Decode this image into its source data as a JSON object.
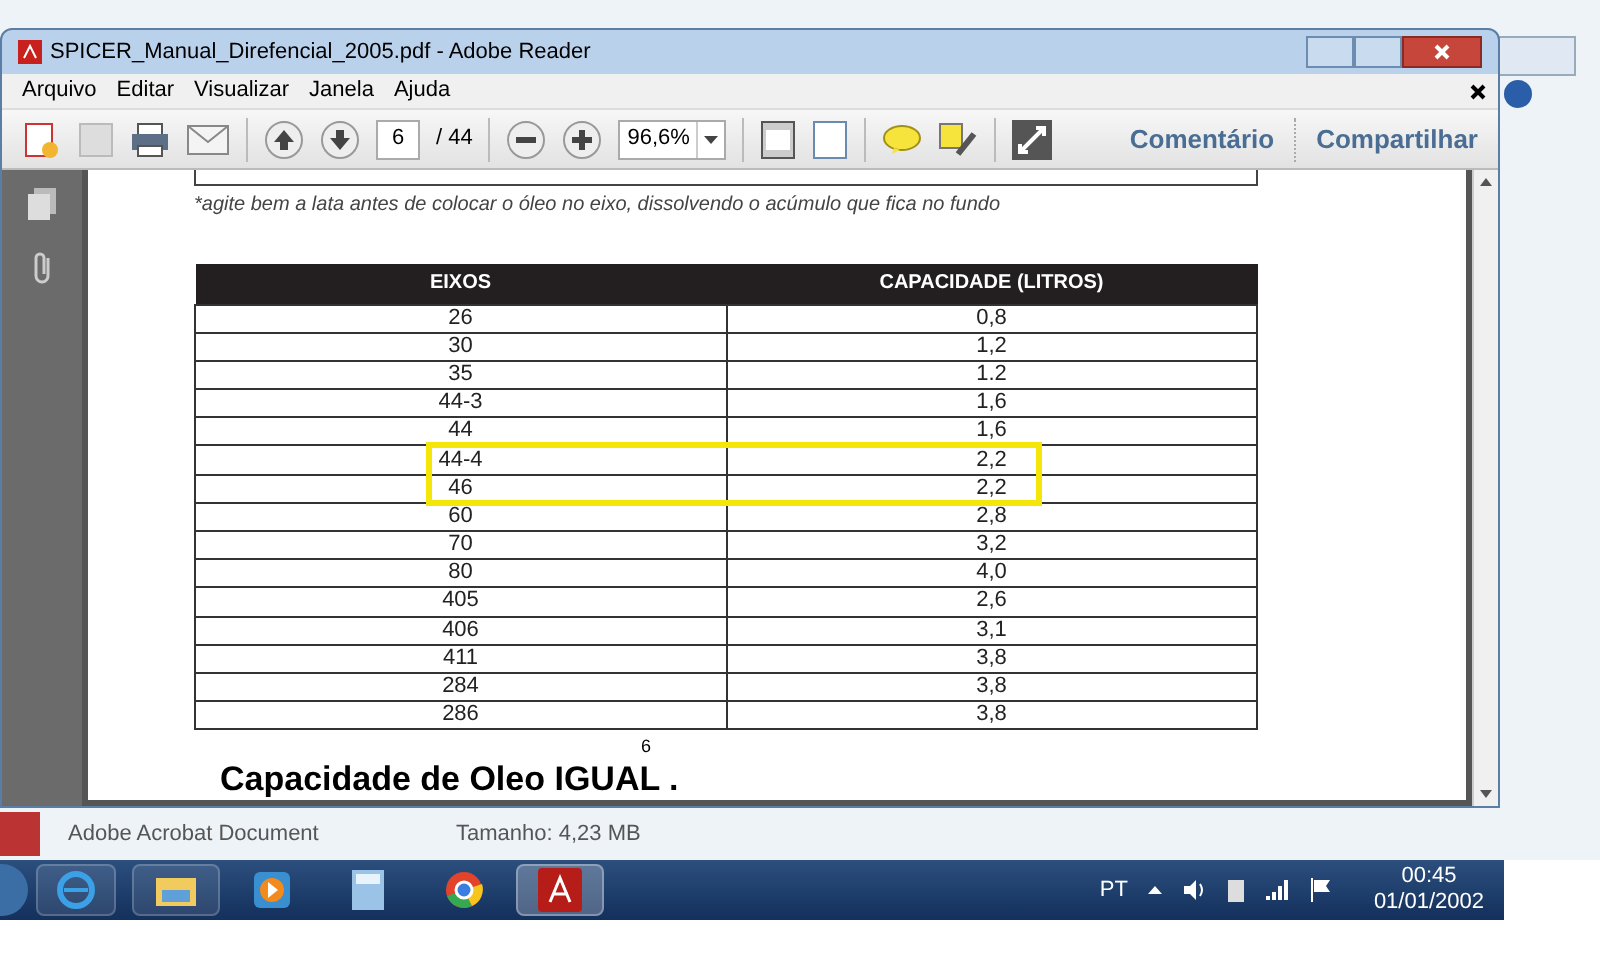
{
  "window": {
    "title": "SPICER_Manual_Direfencial_2005.pdf - Adobe Reader"
  },
  "menu": [
    "Arquivo",
    "Editar",
    "Visualizar",
    "Janela",
    "Ajuda"
  ],
  "toolbar": {
    "page": "6",
    "page_count": "/ 44",
    "zoom": "96,6%",
    "tabs": [
      "Comentário",
      "Compartilhar"
    ]
  },
  "document": {
    "note": "*agite bem a lata antes de colocar o óleo no eixo, dissolvendo o acúmulo que fica no fundo",
    "table": {
      "columns": [
        "EIXOS",
        "CAPACIDADE (LITROS)"
      ],
      "rows": [
        {
          "cells": [
            "26",
            "0,8"
          ],
          "highlighted": false
        },
        {
          "cells": [
            "30",
            "1,2"
          ],
          "highlighted": false
        },
        {
          "cells": [
            "35",
            "1.2"
          ],
          "highlighted": false
        },
        {
          "cells": [
            "44-3",
            "1,6"
          ],
          "highlighted": false
        },
        {
          "cells": [
            "44",
            "1,6"
          ],
          "highlighted": false
        },
        {
          "cells": [
            "44-4",
            "2,2"
          ],
          "highlighted": true
        },
        {
          "cells": [
            "46",
            "2,2"
          ],
          "highlighted": true
        },
        {
          "cells": [
            "60",
            "2,8"
          ],
          "highlighted": false
        },
        {
          "cells": [
            "70",
            "3,2"
          ],
          "highlighted": false
        },
        {
          "cells": [
            "80",
            "4,0"
          ],
          "highlighted": false
        },
        {
          "cells": [
            "405",
            "2,6"
          ],
          "highlighted": false
        },
        {
          "cells": [
            "406",
            "3,1"
          ],
          "highlighted": false
        },
        {
          "cells": [
            "411",
            "3,8"
          ],
          "highlighted": false
        },
        {
          "cells": [
            "284",
            "3,8"
          ],
          "highlighted": false
        },
        {
          "cells": [
            "286",
            "3,8"
          ],
          "highlighted": false
        }
      ]
    },
    "page_number": "6",
    "caption": "Capacidade de Oleo IGUAL ."
  },
  "details_bar": {
    "type": "Adobe Acrobat Document",
    "size": "Tamanho: 4,23 MB"
  },
  "tray": {
    "language": "PT",
    "time": "00:45",
    "date": "01/01/2002"
  }
}
